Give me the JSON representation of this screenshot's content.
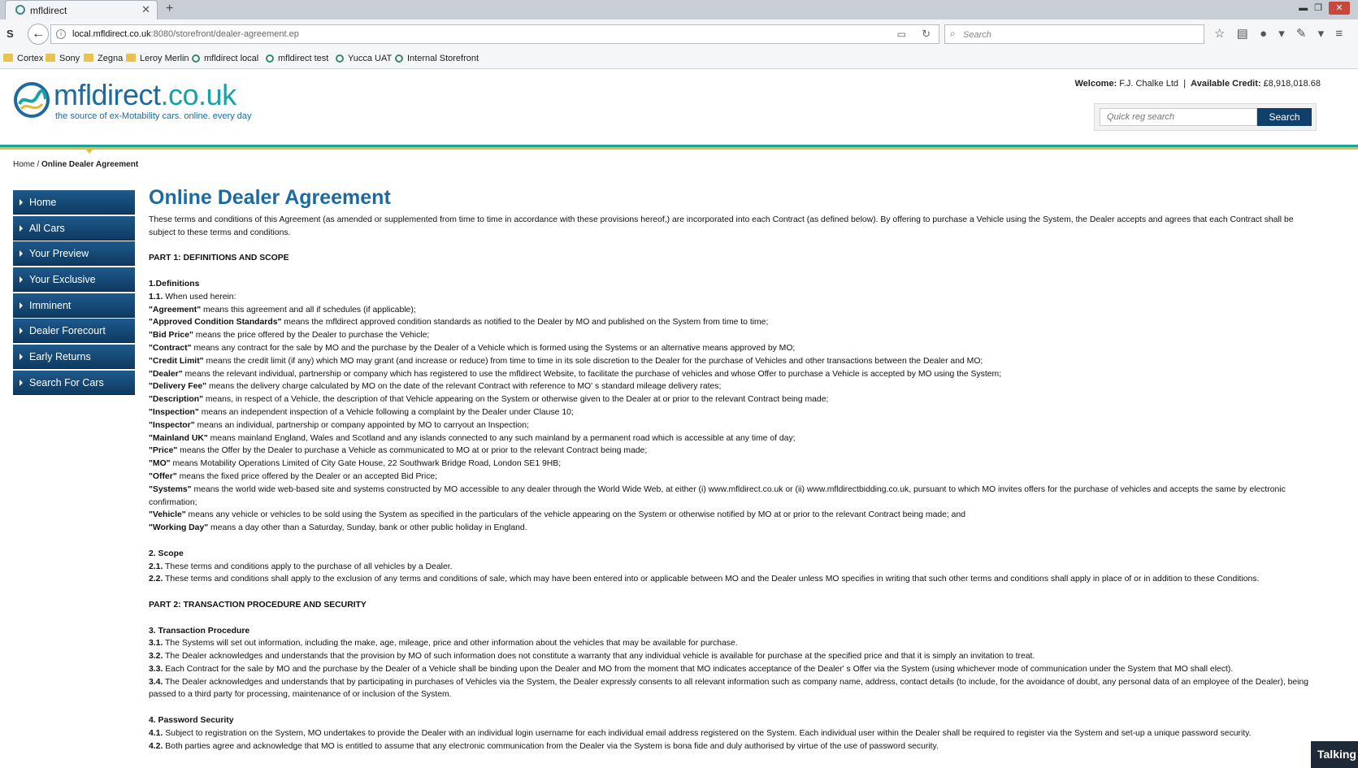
{
  "browser": {
    "tab_title": "mfldirect",
    "url_host": "local.mfldirect.co.uk",
    "url_rest": ":8080/storefront/dealer-agreement.ep",
    "search_placeholder": "Search",
    "bookmarks": [
      {
        "label": "Cortex",
        "icon": "folder-icon"
      },
      {
        "label": "Sony",
        "icon": "folder-icon"
      },
      {
        "label": "Zegna",
        "icon": "folder-icon"
      },
      {
        "label": "Leroy Merlin",
        "icon": "folder-icon"
      },
      {
        "label": "mfldirect local",
        "icon": "globe-icon"
      },
      {
        "label": "mfldirect test",
        "icon": "globe-icon"
      },
      {
        "label": "Yucca UAT",
        "icon": "globe-icon"
      },
      {
        "label": "Internal Storefront",
        "icon": "globe-icon"
      }
    ]
  },
  "site": {
    "logo_name": "mfldirect",
    "logo_tld": ".co.uk",
    "logo_tagline": "the source of ex-Motability cars. online. every day",
    "welcome_label": "Welcome:",
    "welcome_name": "F.J. Chalke Ltd",
    "separator": "|",
    "credit_label": "Available Credit:",
    "credit_value": "£8,918,018.68",
    "quick_reg_placeholder": "Quick reg search",
    "search_button": "Search",
    "colors": {
      "brand_blue": "#1c6aa0",
      "brand_teal": "#1aa3a3",
      "brand_yellow": "#e9b82c",
      "nav_dark": "#0e3a62"
    }
  },
  "breadcrumb": {
    "home": "Home",
    "separator": "/",
    "current": "Online Dealer Agreement"
  },
  "sidenav": [
    "Home",
    "All Cars",
    "Your Preview",
    "Your Exclusive",
    "Imminent",
    "Dealer Forecourt",
    "Early Returns",
    "Search For Cars"
  ],
  "page": {
    "title": "Online Dealer Agreement",
    "intro": "These terms and conditions of this Agreement (as amended or supplemented from time to time in accordance with these provisions hereof,) are incorporated into each Contract (as defined below). By offering to purchase a Vehicle using the System, the Dealer accepts and agrees that each Contract shall be subject to these terms and conditions.",
    "part1": "PART 1: DEFINITIONS AND SCOPE",
    "def_heading": "1.Definitions",
    "def_intro_num": "1.1.",
    "def_intro": " When used herein:",
    "definitions": [
      {
        "term": "\"Agreement\"",
        "text": " means this agreement and all if schedules (if applicable);"
      },
      {
        "term": "\"Approved Condition Standards\"",
        "text": " means the mfldirect approved condition standards as notified to the Dealer by MO and published on the System from time to time;"
      },
      {
        "term": "\"Bid Price\"",
        "text": " means the price offered by the Dealer to purchase the Vehicle;"
      },
      {
        "term": "\"Contract\"",
        "text": " means any contract for the sale by MO and the purchase by the Dealer of a Vehicle which is formed using the Systems or an alternative means approved by MO;"
      },
      {
        "term": "\"Credit Limit\"",
        "text": " means the credit limit (if any) which MO may grant (and increase or reduce) from time to time in its sole discretion to the Dealer for the purchase of Vehicles and other transactions between the Dealer and MO;"
      },
      {
        "term": "\"Dealer\"",
        "text": " means the relevant individual, partnership or company which has registered to use the mfldirect Website, to facilitate the purchase of vehicles and whose Offer to purchase a Vehicle is accepted by MO using the System;"
      },
      {
        "term": "\"Delivery Fee\"",
        "text": " means the delivery charge calculated by MO on the date of the relevant Contract with reference to MO' s standard mileage delivery rates;"
      },
      {
        "term": "\"Description\"",
        "text": " means, in respect of a Vehicle, the description of that Vehicle appearing on the System or otherwise given to the Dealer at or prior to the relevant Contract being made;"
      },
      {
        "term": "\"Inspection\"",
        "text": " means an independent inspection of a Vehicle following a complaint by the Dealer under Clause 10;"
      },
      {
        "term": "\"Inspector\"",
        "text": " means an individual, partnership or company appointed by MO to carryout an Inspection;"
      },
      {
        "term": "\"Mainland UK\"",
        "text": " means mainland England, Wales and Scotland and any islands connected to any such mainland by a permanent road which is accessible at any time of day;"
      },
      {
        "term": "\"Price\"",
        "text": " means the Offer by the Dealer to purchase a Vehicle as communicated to MO at or prior to the relevant Contract being made;"
      },
      {
        "term": "\"MO\"",
        "text": " means Motability Operations Limited of City Gate House, 22 Southwark Bridge Road, London SE1 9HB;"
      },
      {
        "term": "\"Offer\"",
        "text": " means the fixed price offered by the Dealer or an accepted Bid Price;"
      },
      {
        "term": "\"Systems\"",
        "text": " means the world wide web-based site and systems constructed by MO accessible to any dealer through the World Wide Web, at either (i) www.mfldirect.co.uk or (ii) www.mfldirectbidding.co.uk, pursuant to which MO invites offers for the purchase of vehicles and accepts the same by electronic confirmation;"
      },
      {
        "term": "\"Vehicle\"",
        "text": " means any vehicle or vehicles to be sold using the System as specified in the particulars of the vehicle appearing on the System or otherwise notified by MO at or prior to the relevant Contract being made; and"
      },
      {
        "term": "\"Working Day\"",
        "text": " means a day other than a Saturday, Sunday, bank or other public holiday in England."
      }
    ],
    "scope_heading": "2. Scope",
    "scope": [
      {
        "num": "2.1.",
        "text": " These terms and conditions apply to the purchase of all vehicles by a Dealer."
      },
      {
        "num": "2.2.",
        "text": " These terms and conditions shall apply to the exclusion of any terms and conditions of sale, which may have been entered into or applicable between MO and the Dealer unless MO specifies in writing that such other terms and conditions shall apply in place of or in addition to these Conditions."
      }
    ],
    "part2": "PART 2: TRANSACTION PROCEDURE AND SECURITY",
    "tp_heading": "3. Transaction Procedure",
    "tp": [
      {
        "num": "3.1.",
        "text": " The Systems will set out information, including the make, age, mileage, price and other information about the vehicles that may be available for purchase."
      },
      {
        "num": "3.2.",
        "text": " The Dealer acknowledges and understands that the provision by MO of such information does not constitute a warranty that any individual vehicle is available for purchase at the specified price and that it is simply an invitation to treat."
      },
      {
        "num": "3.3.",
        "text": " Each Contract for the sale by MO and the purchase by the Dealer of a Vehicle shall be binding upon the Dealer and MO from the moment that MO indicates acceptance of the Dealer' s Offer via the System (using whichever mode of communication under the System that MO shall elect)."
      },
      {
        "num": "3.4.",
        "text": " The Dealer acknowledges and understands that by participating in purchases of Vehicles via the System, the Dealer expressly consents to all relevant information such as company name, address, contact details (to include, for the avoidance of doubt, any personal data of an employee of the Dealer), being passed to a third party for processing, maintenance of or inclusion of the System."
      }
    ],
    "ps_heading": "4. Password Security",
    "ps": [
      {
        "num": "4.1.",
        "text": " Subject to registration on the System, MO undertakes to provide the Dealer with an individual login username for each individual email address registered on the System. Each individual user within the Dealer shall be required to register via the System and set-up a unique password security."
      },
      {
        "num": "4.2.",
        "text": " Both parties agree and acknowledge that MO is entitled to assume that any electronic communication from the Dealer via the System is bona fide and duly authorised by virtue of the use of password security."
      }
    ]
  },
  "chat_widget": "Talking"
}
